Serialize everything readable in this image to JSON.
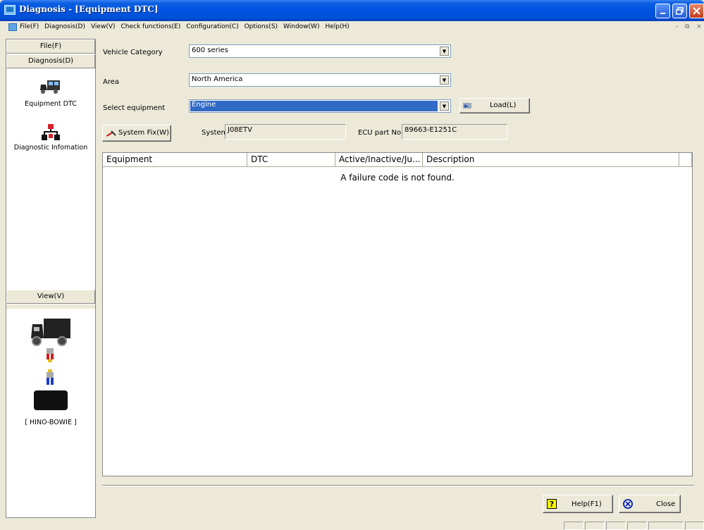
{
  "window": {
    "title": "Diagnosis - [Equipment DTC]"
  },
  "menu": [
    "File(F)",
    "Diagnosis(D)",
    "View(V)",
    "Check functions(E)",
    "Configuration(C)",
    "Options(S)",
    "Window(W)",
    "Help(H)"
  ],
  "sidebar": {
    "file_header": "File(F)",
    "diagnosis_header": "Diagnosis(D)",
    "items": [
      {
        "label": "Equipment DTC",
        "icon": "truck-icon"
      },
      {
        "label": "Diagnostic Infomation",
        "icon": "network-icon"
      }
    ],
    "view_header": "View(V)",
    "device_label": "[ HINO-BOWIE ]"
  },
  "form": {
    "vehicle_category_label": "Vehicle Category",
    "vehicle_category_value": "600 series",
    "area_label": "Area",
    "area_value": "North America",
    "select_equipment_label": "Select equipment",
    "select_equipment_value": "Engine",
    "load_button": "Load(L)",
    "system_fix_button": "System Fix(W)",
    "system_label": "System",
    "system_value": "J08ETV",
    "ecu_label": "ECU part No.",
    "ecu_value": "89663-E1251C"
  },
  "table": {
    "columns": [
      "Equipment",
      "DTC",
      "Active/Inactive/Ju...",
      "Description"
    ],
    "empty_message": "A failure code is not found."
  },
  "footer": {
    "help_button": "Help(F1)",
    "close_button": "Close"
  },
  "colors": {
    "title_bar": "#0054e3",
    "selection": "#316ac5",
    "face": "#ece9d8"
  }
}
